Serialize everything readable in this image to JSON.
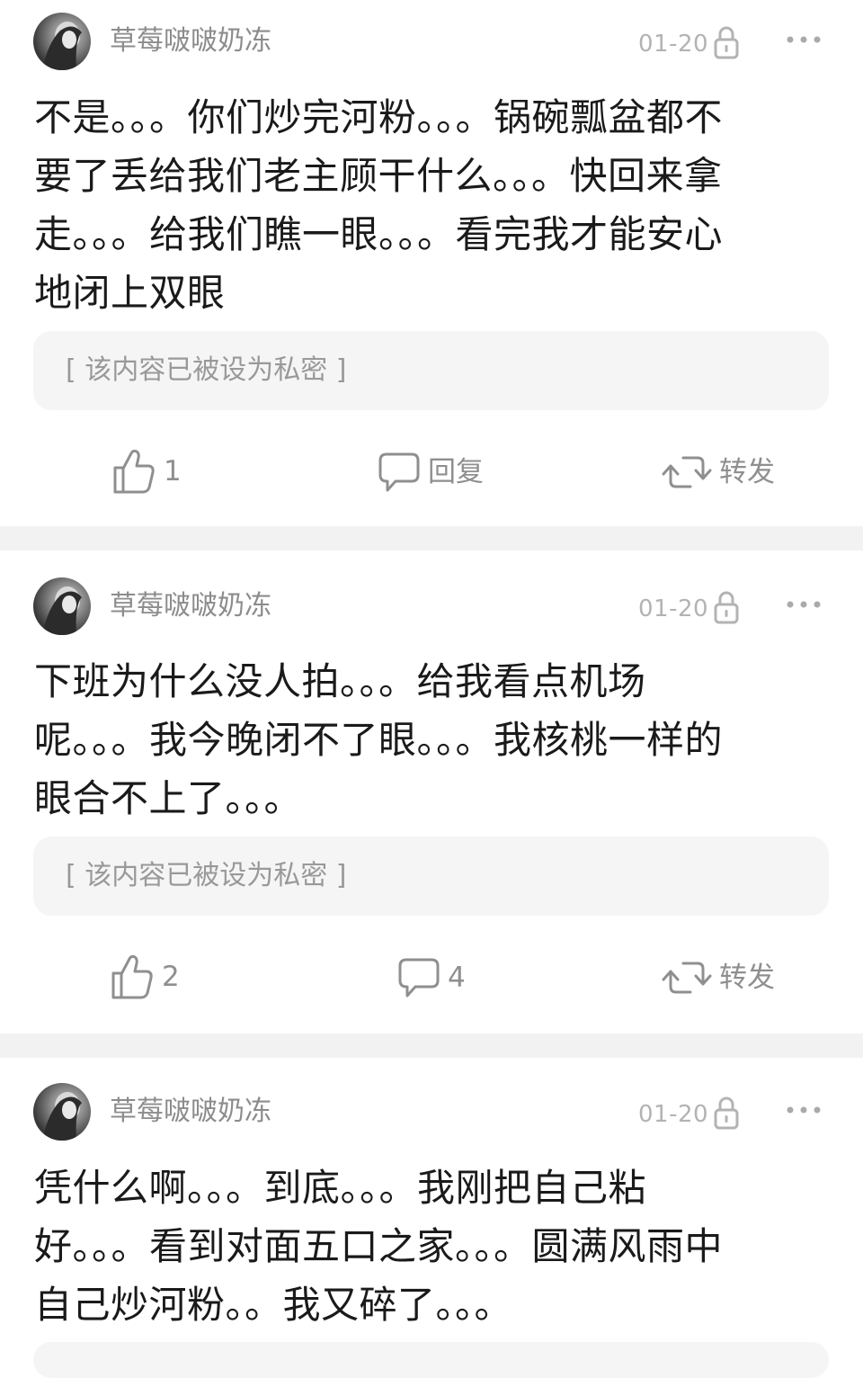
{
  "posts": [
    {
      "username": "草莓啵啵奶冻",
      "date": "01-20",
      "content_lines": [
        "不是。。。你们炒完河粉。。。锅碗瓢盆都不",
        "要了丢给我们老主顾干什么。。。快回来拿",
        "走。。。给我们瞧一眼。。。看完我才能安心",
        "地闭上双眼"
      ],
      "private_notice": "[ 该内容已被设为私密 ]",
      "like_count": "1",
      "reply_label": "回复",
      "repost_label": "转发"
    },
    {
      "username": "草莓啵啵奶冻",
      "date": "01-20",
      "content_lines": [
        "下班为什么没人拍。。。给我看点机场",
        "呢。。。我今晚闭不了眼。。。我核桃一样的",
        "眼合不上了。。。"
      ],
      "private_notice": "[ 该内容已被设为私密 ]",
      "like_count": "2",
      "reply_label": "4",
      "repost_label": "转发"
    },
    {
      "username": "草莓啵啵奶冻",
      "date": "01-20",
      "content_lines": [
        "凭什么啊。。。到底。。。我刚把自己粘",
        "好。。。看到对面五口之家。。。圆满风雨中",
        "自己炒河粉。。我又碎了。。。"
      ]
    }
  ],
  "colors": {
    "separator": "#f2f2f2",
    "private_box": "#f5f5f5",
    "meta_text": "#8c8c8c"
  }
}
